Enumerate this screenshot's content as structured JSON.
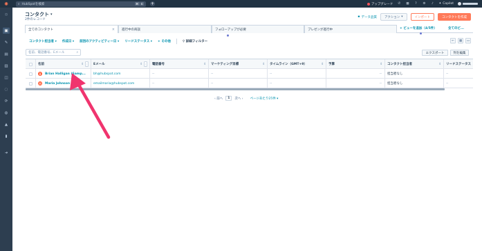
{
  "topbar": {
    "search_placeholder": "HubSpotを検索",
    "shortcut_keys": [
      "⌘",
      "K"
    ],
    "upgrade_label": "アップグレード",
    "copilot_label": "Copilot"
  },
  "header": {
    "title": "コンタクト",
    "record_count": "2件のレコード",
    "data_quality": "データ品質",
    "actions_label": "アクション",
    "import_label": "インポート",
    "create_label": "コンタクトを作成"
  },
  "tabs": [
    {
      "label": "全てのコンタクト",
      "closable": true
    },
    {
      "label": "進行中の商談",
      "closable": false
    },
    {
      "label": "フォローアップが必要",
      "closable": false
    },
    {
      "label": "プレゼンが進行中",
      "closable": false
    }
  ],
  "add_view_label": "+ ビューを追加（4/5件）",
  "all_views_label": "全てのビ...",
  "filters": [
    "コンタクト担当者",
    "作成日",
    "前回のアクティビティー日",
    "リードステータス",
    "+ その他"
  ],
  "advanced_filter_label": "詳細フィルター",
  "table_search_placeholder": "名前、電話番号、Eメール",
  "export_label": "エクスポート",
  "edit_columns_label": "列を編集",
  "columns": [
    "名前",
    "Eメール",
    "電話番号",
    "マーケティング目標",
    "タイムライン（GMT+9）",
    "予算",
    "コンタクト担当者",
    "リードステータス"
  ],
  "rows": [
    {
      "initial": "B",
      "name": "Brian Halligan (Samp...",
      "email": "bh@hubspot.com",
      "phone": "--",
      "marketing": "--",
      "timeline": "--",
      "budget": "--",
      "owner": "担当者なし",
      "lead": "--"
    },
    {
      "initial": "M",
      "name": "Maria Johnson",
      "email": "emailmaria@hubspot.com",
      "phone": "--",
      "marketing": "--",
      "timeline": "--",
      "budget": "--",
      "owner": "担当者なし",
      "lead": "--"
    }
  ],
  "pagination": {
    "prev": "前へ",
    "current": "1",
    "next": "次へ",
    "per_page": "ページあたり25件"
  },
  "colors": {
    "nav_bg": "#213343",
    "accent_orange": "#ff7a59",
    "link_teal": "#0091ae",
    "annotation_arrow": "#f0346e"
  }
}
